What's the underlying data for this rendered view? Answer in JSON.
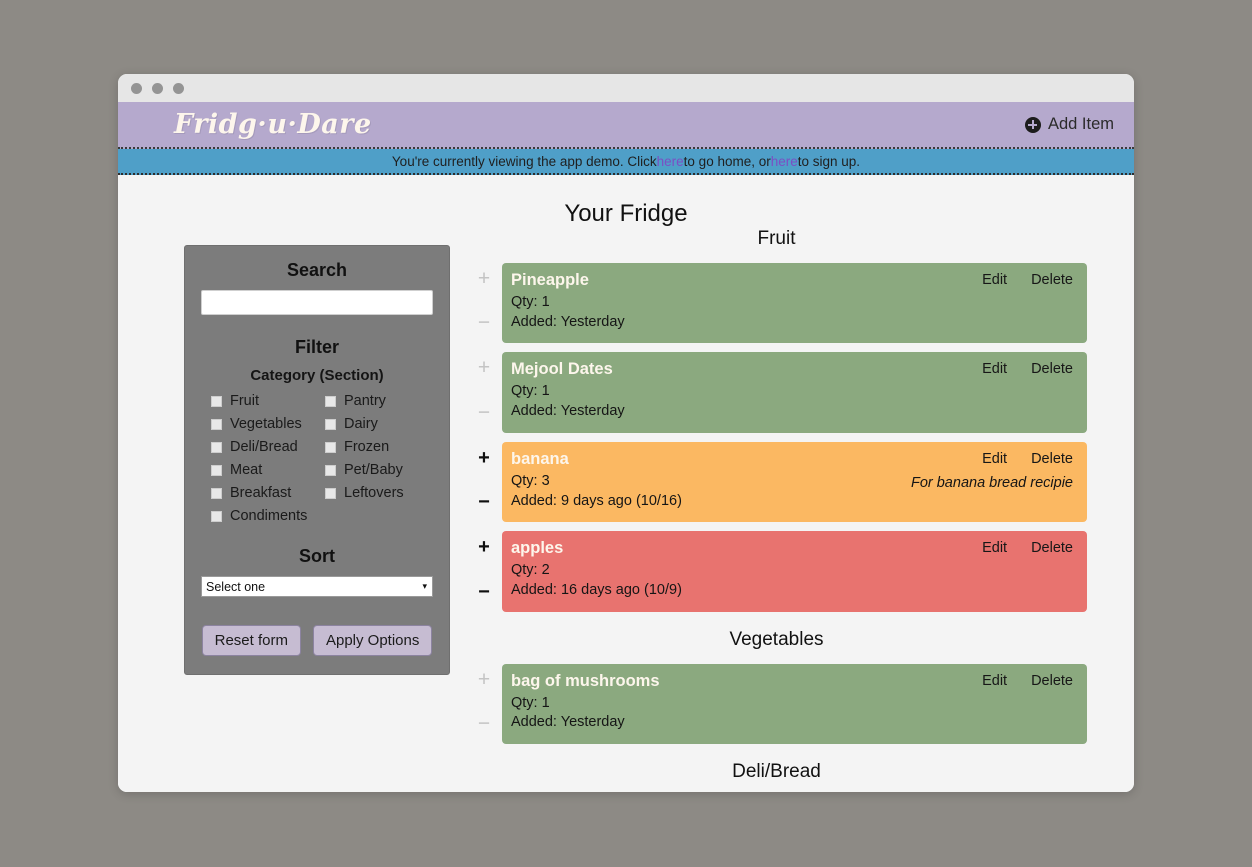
{
  "window": {
    "dots": [
      "close-dot",
      "minimize-dot",
      "maximize-dot"
    ]
  },
  "header": {
    "logo": "Fridg·u·Dare",
    "add_item_label": "Add Item",
    "add_item_icon": "plus-circle-icon",
    "background_color": "#b5a9cd"
  },
  "demo_banner": {
    "text_before": "You're currently viewing the app demo. Click ",
    "link_home": "here",
    "text_middle": " to go home, or ",
    "link_signup": "here",
    "text_after": " to sign up.",
    "background_color": "#4f9fc8",
    "link_color": "#7b4fc4"
  },
  "page": {
    "title": "Your Fridge"
  },
  "sidebar": {
    "search_heading": "Search",
    "search_value": "",
    "search_placeholder": "",
    "filter_heading": "Filter",
    "category_heading": "Category (Section)",
    "categories": [
      {
        "label": "Fruit",
        "checked": false
      },
      {
        "label": "Pantry",
        "checked": false
      },
      {
        "label": "Vegetables",
        "checked": false
      },
      {
        "label": "Dairy",
        "checked": false
      },
      {
        "label": "Deli/Bread",
        "checked": false
      },
      {
        "label": "Frozen",
        "checked": false
      },
      {
        "label": "Meat",
        "checked": false
      },
      {
        "label": "Pet/Baby",
        "checked": false
      },
      {
        "label": "Breakfast",
        "checked": false
      },
      {
        "label": "Leftovers",
        "checked": false
      },
      {
        "label": "Condiments",
        "checked": false
      }
    ],
    "sort_heading": "Sort",
    "sort_selected": "Select one",
    "sort_caret": "▾",
    "reset_label": "Reset form",
    "apply_label": "Apply Options"
  },
  "fridge": {
    "actions": {
      "edit": "Edit",
      "delete": "Delete"
    },
    "stepper": {
      "increase": "+",
      "decrease": "−"
    },
    "sections": [
      {
        "name": "Fruit",
        "items": [
          {
            "title": "Pineapple",
            "qty": "Qty: 1",
            "added": "Added: Yesterday",
            "note": "",
            "freshness": "green",
            "stepper_state": "dim"
          },
          {
            "title": "Mejool Dates",
            "qty": "Qty: 1",
            "added": "Added: Yesterday",
            "note": "",
            "freshness": "green",
            "stepper_state": "dim"
          },
          {
            "title": "banana",
            "qty": "Qty: 3",
            "added": "Added: 9 days ago (10/16)",
            "note": "For banana bread recipie",
            "freshness": "orange",
            "stepper_state": "strong"
          },
          {
            "title": "apples",
            "qty": "Qty: 2",
            "added": "Added: 16 days ago (10/9)",
            "note": "",
            "freshness": "red",
            "stepper_state": "strong"
          }
        ]
      },
      {
        "name": "Vegetables",
        "items": [
          {
            "title": "bag of mushrooms",
            "qty": "Qty: 1",
            "added": "Added: Yesterday",
            "note": "",
            "freshness": "green",
            "stepper_state": "dim"
          }
        ]
      },
      {
        "name": "Deli/Bread",
        "items": []
      }
    ]
  },
  "colors": {
    "fresh_green": "#8ba97f",
    "warning_orange": "#fbb862",
    "expired_red": "#e8736f",
    "header_purple": "#b5a9cd",
    "banner_blue": "#4f9fc8",
    "sidebar_gray": "#7c7c7c",
    "button_purple": "#c6bcd2"
  }
}
